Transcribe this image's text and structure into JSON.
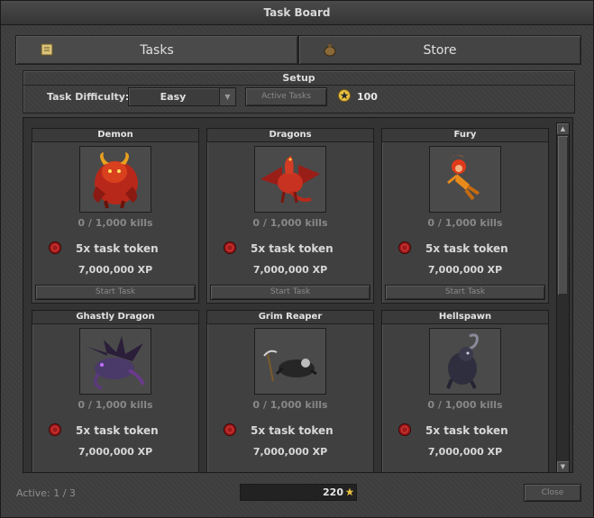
{
  "window": {
    "title": "Task Board"
  },
  "tabs": [
    {
      "label": "Tasks",
      "icon": "scroll-icon",
      "active": true
    },
    {
      "label": "Store",
      "icon": "bag-icon",
      "active": false
    }
  ],
  "setup": {
    "title": "Setup",
    "difficulty_label": "Task Difficulty:",
    "difficulty_value": "Easy",
    "active_tasks_button": "Active Tasks",
    "tokens": "100"
  },
  "tasks": [
    {
      "name": "Demon",
      "kills": "0 / 1,000 kills",
      "reward": "5x task token",
      "xp": "7,000,000 XP",
      "button": "Start Task"
    },
    {
      "name": "Dragons",
      "kills": "0 / 1,000 kills",
      "reward": "5x task token",
      "xp": "7,000,000 XP",
      "button": "Start Task"
    },
    {
      "name": "Fury",
      "kills": "0 / 1,000 kills",
      "reward": "5x task token",
      "xp": "7,000,000 XP",
      "button": "Start Task"
    },
    {
      "name": "Ghastly Dragon",
      "kills": "0 / 1,000 kills",
      "reward": "5x task token",
      "xp": "7,000,000 XP"
    },
    {
      "name": "Grim Reaper",
      "kills": "0 / 1,000 kills",
      "reward": "5x task token",
      "xp": "7,000,000 XP"
    },
    {
      "name": "Hellspawn",
      "kills": "0 / 1,000 kills",
      "reward": "5x task token",
      "xp": "7,000,000 XP"
    }
  ],
  "footer": {
    "active_label": "Active: 1 / 3",
    "balance": "220",
    "close_label": "Close"
  },
  "colors": {
    "accent_gold": "#e8c040",
    "token_red": "#a01818"
  }
}
